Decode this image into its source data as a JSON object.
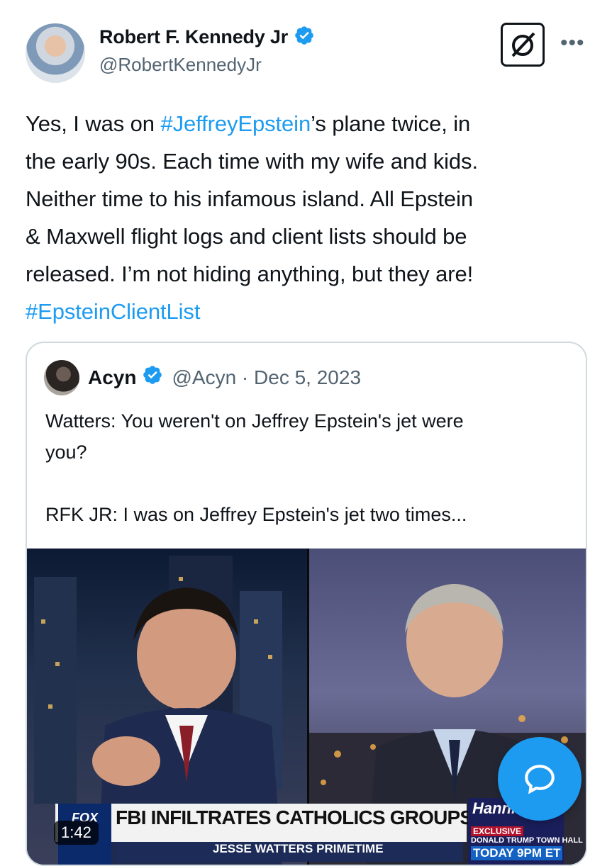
{
  "tweet": {
    "author_name": "Robert F. Kennedy Jr",
    "author_handle": "@RobertKennedyJr",
    "icons": [
      "verified-icon",
      "grok-icon",
      "more-icon"
    ],
    "text_lines": [
      [
        "Yes, I was on ",
        "#JeffreyEpstein",
        "’s plane twice, in"
      ],
      "the early 90s. Each time with my wife and kids.",
      "Neither time to his infamous island. All Epstein",
      "& Maxwell flight logs and client lists should be",
      "released. I’m not hiding anything, but they are!",
      "#EpsteinClientList"
    ]
  },
  "quoted": {
    "author_name": "Acyn",
    "author_handle": "@Acyn",
    "separator": " · ",
    "date": "Dec 5, 2023",
    "text_lines": [
      "Watters: You weren't on Jeffrey Epstein's jet were",
      "you?",
      "",
      "RFK JR: I was on Jeffrey Epstein's jet two times..."
    ],
    "video": {
      "duration": "1:42",
      "network": "FOX",
      "chyron": "FBI INFILTRATES CATHOLICS GROUPS",
      "subchyron": "JESSE WATTERS PRIMETIME",
      "promo_title": "Hanni",
      "promo_tag": "EXCLUSIVE",
      "promo_event": "DONALD TRUMP TOWN HALL",
      "promo_time": "TODAY 9PM ET"
    }
  },
  "colors": {
    "link": "#1d9bf0",
    "secondary_text": "#536471",
    "border": "#cfd9de",
    "fab": "#1d9bf0"
  }
}
